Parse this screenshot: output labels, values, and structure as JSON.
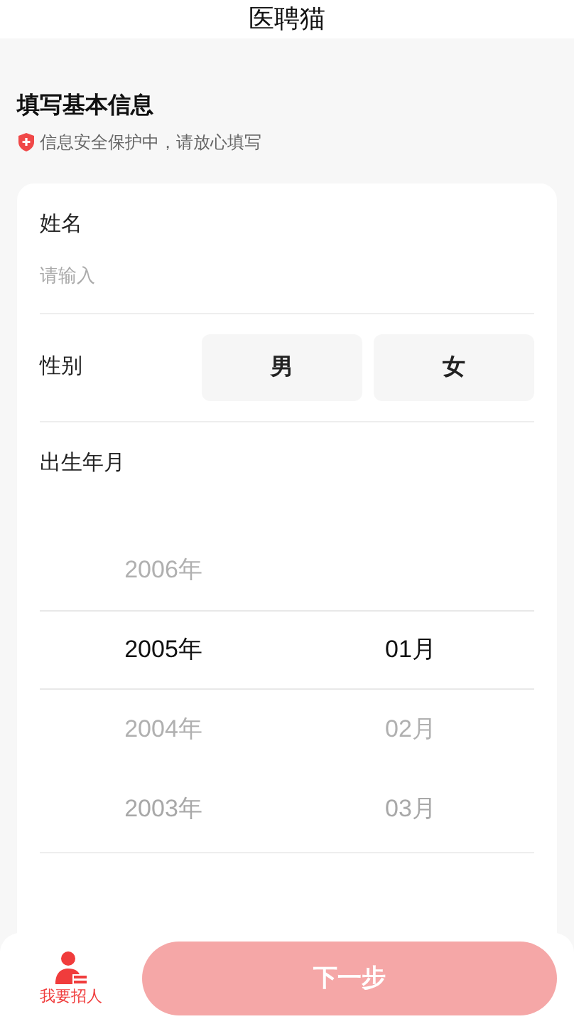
{
  "header": {
    "title": "医聘猫"
  },
  "intro": {
    "title": "填写基本信息",
    "notice": "信息安全保护中，请放心填写"
  },
  "name_field": {
    "label": "姓名",
    "placeholder": "请输入"
  },
  "gender": {
    "label": "性别",
    "options": [
      {
        "label": "男",
        "selected": false
      },
      {
        "label": "女",
        "selected": false
      }
    ]
  },
  "birth": {
    "label": "出生年月",
    "years": [
      {
        "label": "2006年",
        "selected": false
      },
      {
        "label": "2005年",
        "selected": true
      },
      {
        "label": "2004年",
        "selected": false
      },
      {
        "label": "2003年",
        "selected": false
      }
    ],
    "months": [
      {
        "label": "01月",
        "selected": true
      },
      {
        "label": "02月",
        "selected": false
      },
      {
        "label": "03月",
        "selected": false
      }
    ]
  },
  "footer": {
    "recruit_label": "我要招人",
    "next_button": "下一步"
  }
}
